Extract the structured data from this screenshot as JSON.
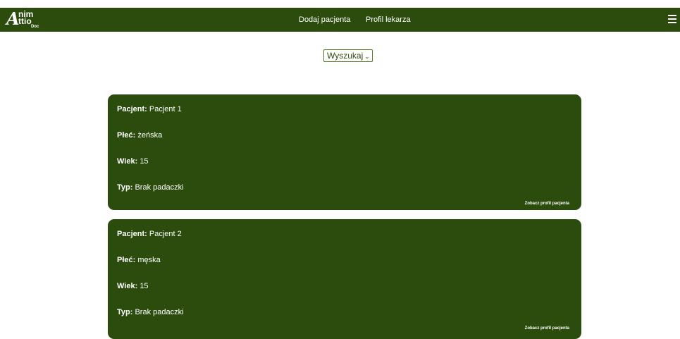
{
  "header": {
    "logo": {
      "big": "A",
      "line1": "nim",
      "line2": "ttio",
      "line3": "Doc"
    },
    "nav": {
      "add_patient": "Dodaj pacjenta",
      "doctor_profile": "Profil lekarza"
    }
  },
  "search": {
    "label": "Wyszukaj"
  },
  "patients": [
    {
      "patient_label": "Pacjent:",
      "patient_value": "Pacjent 1",
      "sex_label": "Płeć:",
      "sex_value": "żeńska",
      "age_label": "Wiek:",
      "age_value": "15",
      "type_label": "Typ:",
      "type_value": "Brak padaczki",
      "link": "Zobacz profil pacjenta"
    },
    {
      "patient_label": "Pacjent:",
      "patient_value": "Pacjent 2",
      "sex_label": "Płeć:",
      "sex_value": "męska",
      "age_label": "Wiek:",
      "age_value": "15",
      "type_label": "Typ:",
      "type_value": "Brak padaczki",
      "link": "Zobacz profil pacjenta"
    }
  ],
  "colors": {
    "brand_green": "#2b4c0d",
    "background": "#ffffff"
  }
}
